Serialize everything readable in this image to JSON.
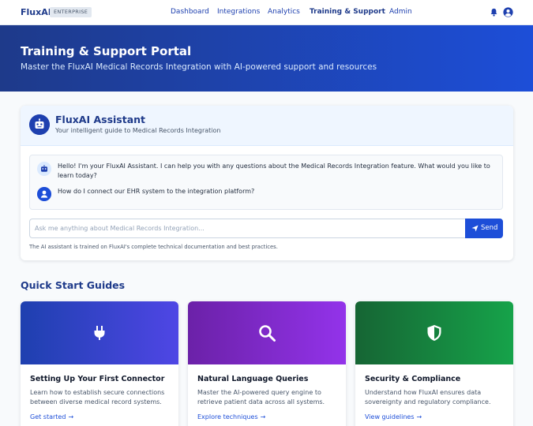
{
  "header": {
    "logo": "FluxAI",
    "badge": "ENTERPRISE",
    "nav": [
      "Dashboard",
      "Integrations",
      "Analytics",
      "Training & Support",
      "Admin"
    ],
    "active_nav": "Training & Support",
    "icons": [
      "bell-icon",
      "user-circle-icon"
    ]
  },
  "hero": {
    "title": "Training & Support Portal",
    "subtitle": "Master the FluxAI Medical Records Integration with AI-powered support and resources"
  },
  "assistant": {
    "title": "FluxAI Assistant",
    "subtitle": "Your intelligent guide to Medical Records Integration",
    "messages": [
      {
        "from": "bot",
        "text": "Hello! I'm your FluxAI Assistant. I can help you with any questions about the Medical Records Integration feature. What would you like to learn today?"
      },
      {
        "from": "user",
        "text": "How do I connect our EHR system to the integration platform?"
      }
    ],
    "input_placeholder": "Ask me anything about Medical Records Integration...",
    "send_label": "Send",
    "note": "The AI assistant is trained on FluxAI's complete technical documentation and best practices."
  },
  "quick_start": {
    "title": "Quick Start Guides",
    "guides": [
      {
        "title": "Setting Up Your First Connector",
        "description": "Learn how to establish secure connections between diverse medical record systems.",
        "link": "Get started",
        "icon": "plug-icon",
        "colors": [
          "#1e40af",
          "#4f46e5"
        ]
      },
      {
        "title": "Natural Language Queries",
        "description": "Master the AI-powered query engine to retrieve patient data across all systems.",
        "link": "Explore techniques",
        "icon": "search-icon",
        "colors": [
          "#6b21a8",
          "#9333ea"
        ]
      },
      {
        "title": "Security & Compliance",
        "description": "Understand how FluxAI ensures data sovereignty and regulatory compliance.",
        "link": "View guidelines",
        "icon": "shield-icon",
        "colors": [
          "#166534",
          "#16a34a"
        ]
      }
    ]
  },
  "colors": {
    "primary": "#1d4ed8",
    "navy": "#1e3a8a"
  }
}
